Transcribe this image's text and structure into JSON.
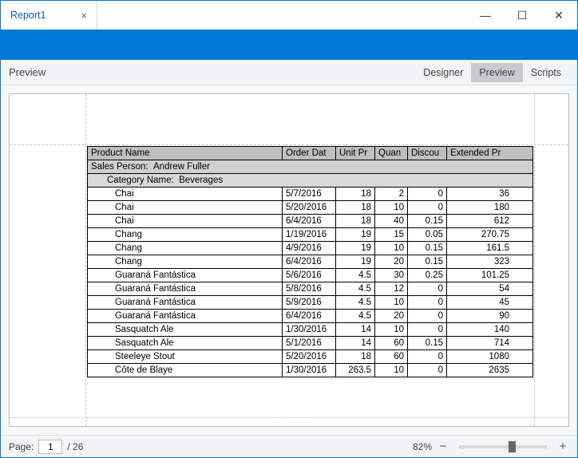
{
  "window": {
    "tab_title": "Report1",
    "minimize": "—",
    "maximize": "☐",
    "close": "✕"
  },
  "toolbar": {
    "mode_label": "Preview",
    "tabs": {
      "designer": "Designer",
      "preview": "Preview",
      "scripts": "Scripts"
    }
  },
  "report": {
    "columns": {
      "product": "Product Name",
      "orderdate": "Order Dat",
      "unitpr": "Unit Pr",
      "quan": "Quan",
      "discou": "Discou",
      "extpr": "Extended Pr"
    },
    "group1": {
      "label": "Sales Person:",
      "value": "Andrew Fuller"
    },
    "group2": {
      "label": "Category Name:",
      "value": "Beverages"
    },
    "rows": [
      {
        "product": "Chai",
        "date": "5/7/2016",
        "unit": "18",
        "qty": "2",
        "disc": "0",
        "ext": "36"
      },
      {
        "product": "Chai",
        "date": "5/20/2016",
        "unit": "18",
        "qty": "10",
        "disc": "0",
        "ext": "180"
      },
      {
        "product": "Chai",
        "date": "6/4/2016",
        "unit": "18",
        "qty": "40",
        "disc": "0.15",
        "ext": "612"
      },
      {
        "product": "Chang",
        "date": "1/19/2016",
        "unit": "19",
        "qty": "15",
        "disc": "0.05",
        "ext": "270.75"
      },
      {
        "product": "Chang",
        "date": "4/9/2016",
        "unit": "19",
        "qty": "10",
        "disc": "0.15",
        "ext": "161.5"
      },
      {
        "product": "Chang",
        "date": "6/4/2016",
        "unit": "19",
        "qty": "20",
        "disc": "0.15",
        "ext": "323"
      },
      {
        "product": "Guaraná Fantástica",
        "date": "5/6/2016",
        "unit": "4.5",
        "qty": "30",
        "disc": "0.25",
        "ext": "101.25"
      },
      {
        "product": "Guaraná Fantástica",
        "date": "5/8/2016",
        "unit": "4.5",
        "qty": "12",
        "disc": "0",
        "ext": "54"
      },
      {
        "product": "Guaraná Fantástica",
        "date": "5/9/2016",
        "unit": "4.5",
        "qty": "10",
        "disc": "0",
        "ext": "45"
      },
      {
        "product": "Guaraná Fantástica",
        "date": "6/4/2016",
        "unit": "4.5",
        "qty": "20",
        "disc": "0",
        "ext": "90"
      },
      {
        "product": "Sasquatch Ale",
        "date": "1/30/2016",
        "unit": "14",
        "qty": "10",
        "disc": "0",
        "ext": "140"
      },
      {
        "product": "Sasquatch Ale",
        "date": "5/1/2016",
        "unit": "14",
        "qty": "60",
        "disc": "0.15",
        "ext": "714"
      },
      {
        "product": "Steeleye Stout",
        "date": "5/20/2016",
        "unit": "18",
        "qty": "60",
        "disc": "0",
        "ext": "1080"
      },
      {
        "product": "Côte de Blaye",
        "date": "1/30/2016",
        "unit": "263.5",
        "qty": "10",
        "disc": "0",
        "ext": "2635"
      }
    ]
  },
  "status": {
    "page_label": "Page:",
    "page_current": "1",
    "page_total": "/ 26",
    "zoom_pct": "82%"
  }
}
